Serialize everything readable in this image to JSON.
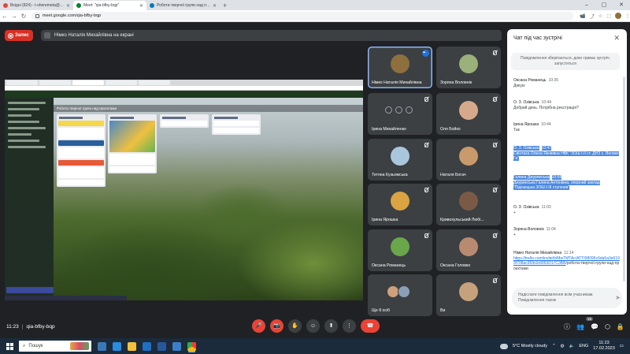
{
  "browser": {
    "tabs": [
      {
        "label": "Вхідні (824) - t-sheremeta@gmail.com",
        "color": "#ea4335",
        "active": false
      },
      {
        "label": "Meet: \"qia-bfby-bqp\"",
        "color": "#00832d",
        "active": true
      },
      {
        "label": "Роботи творчої групи над проєкт...",
        "color": "#0079bf",
        "active": false
      }
    ],
    "new_tab": "+",
    "url": "meet.google.com/qia-bfby-bqp",
    "window_controls": {
      "minimize": "–",
      "maximize": "▢",
      "close": "✕"
    }
  },
  "meet": {
    "record_label": "Запис",
    "presenting_text": "Німко Наталія Михайлівна на екрані",
    "shared_board_title": "Робота творчої групи над проєктами",
    "meeting_code": "qia-bfby-bqp",
    "time": "11:23",
    "time_sep": "|",
    "participant_count_badge": "15",
    "participants": [
      {
        "name": "Німко Наталія Михайлівна",
        "face_color": "#8e6f3e",
        "speaking": true
      },
      {
        "name": "Зоряна Воловнік",
        "face_color": "#9bb07a",
        "speaking": false
      },
      {
        "name": "Ірина Михайленко",
        "face_color": "",
        "speaking": false
      },
      {
        "name": "Оля Бойко",
        "face_color": "#d7a98b",
        "speaking": false
      },
      {
        "name": "Тетяна Кузьомська",
        "face_color": "#a9c6dc",
        "speaking": false
      },
      {
        "name": "Наталя Богач",
        "face_color": "#c99a6b",
        "speaking": false
      },
      {
        "name": "Ірина Ярошка",
        "face_color": "#d9a441",
        "speaking": false
      },
      {
        "name": "Кривохульський Любі...",
        "face_color": "#7a5a46",
        "speaking": false
      },
      {
        "name": "Оксана Романець",
        "face_color": "#6aa64a",
        "speaking": false
      },
      {
        "name": "Оксана Головко",
        "face_color": "#b98a72",
        "speaking": false
      },
      {
        "name": "Ще 8 осіб",
        "face_color": "",
        "speaking": false
      },
      {
        "name": "Ви",
        "face_color": "#c6a27c",
        "speaking": false
      }
    ]
  },
  "chat": {
    "title": "Чат під час зустрічі",
    "close": "✕",
    "note": "Повідомлення зберігаються, доки триває зустріч. запуститься",
    "messages": [
      {
        "sender": "Оксана Романець",
        "time": "10:35",
        "text": "Дякую"
      },
      {
        "sender": "О. З. Озівська",
        "time": "10:44",
        "text": "Добрий день. Потрібна реєстрація?"
      },
      {
        "sender": "Ірина Ярошка",
        "time": "10:44",
        "text": "Так"
      },
      {
        "sender": "О. З. Озівська",
        "time": "10:47",
        "text": "Свінтаха Олена Яковівна НВК \"ЗОШ І-ІІ ст. ДНЗ с. Велике Га\""
      },
      {
        "sender": "Галина Джуринська",
        "time": "10:58",
        "text": "Джуринська Галина Антонівна, опорний заклад \"Підгаєцька ЗОШ І-ІІІ ступенів\""
      },
      {
        "sender": "О. З. Озівська",
        "time": "11:03",
        "text": "+"
      },
      {
        "sender": "Зоряна Воловнік",
        "time": "11:04",
        "text": "+"
      },
      {
        "sender": "Німко Наталія Михайлівна",
        "time": "11:14",
        "link": "https://trello.com/invite/b/MwTMTAc/ATTI98095c6da5a3e6195f708ac9f2b1b9953D17C3BB",
        "text": "/робота-творчої-групи-над-проєктами"
      }
    ],
    "input_placeholder": "Надіслати повідомлення всім учасникам. Повідомлення також",
    "send_icon": "➤"
  },
  "controls": {
    "mic": "🎤",
    "cam": "📷",
    "hand": "✋",
    "emoji": "☺",
    "present": "⬆",
    "more": "⋮",
    "end": "☎",
    "info": "ⓘ",
    "people": "👥",
    "chat": "💬",
    "activities": "⬡",
    "lock": "🔒"
  },
  "taskbar": {
    "search_label": "Пошук",
    "weather": "5°C  Mostly cloudy",
    "lang": "ENG",
    "clock_time": "11:23",
    "clock_date": "17.02.2023"
  }
}
